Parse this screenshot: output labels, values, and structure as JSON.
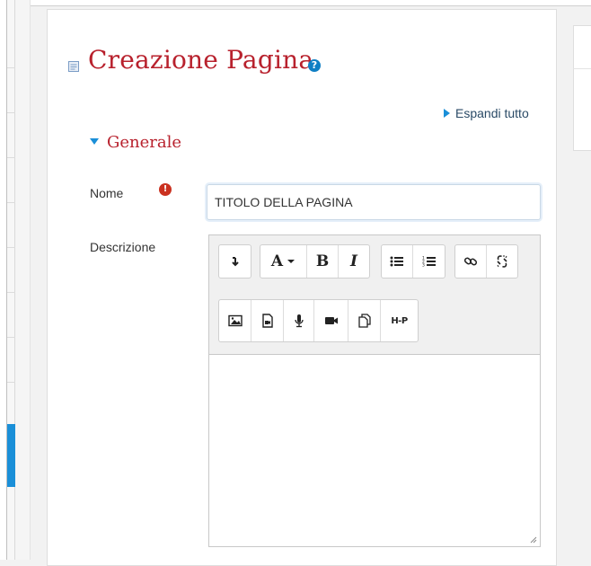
{
  "header": {
    "title": "Creazione Pagina",
    "help_icon": "question-icon",
    "page_icon": "page-icon"
  },
  "actions": {
    "expand_all": "Espandi tutto"
  },
  "section": {
    "title": "Generale"
  },
  "form": {
    "name_label": "Nome",
    "name_value": "TITOLO DELLA PAGINA",
    "description_label": "Descrizione"
  },
  "editor": {
    "toolbar_row1": [
      [
        "collapse-toolbar-icon"
      ],
      [
        "font-style-dropdown-icon",
        "bold-icon",
        "italic-icon"
      ],
      [
        "unordered-list-icon",
        "ordered-list-icon"
      ],
      [
        "link-icon",
        "unlink-icon"
      ]
    ],
    "toolbar_row2": [
      "image-icon",
      "media-icon",
      "record-audio-icon",
      "record-video-icon",
      "manage-files-icon",
      "h5p-icon"
    ],
    "bold_glyph": "B",
    "italic_glyph": "I",
    "font_glyph": "A",
    "h5p_glyph": "H-P"
  },
  "colors": {
    "accent_red": "#b8212d",
    "link_blue": "#1a8fd8",
    "help_blue": "#0f7fc4",
    "required_red": "#ca3120"
  }
}
